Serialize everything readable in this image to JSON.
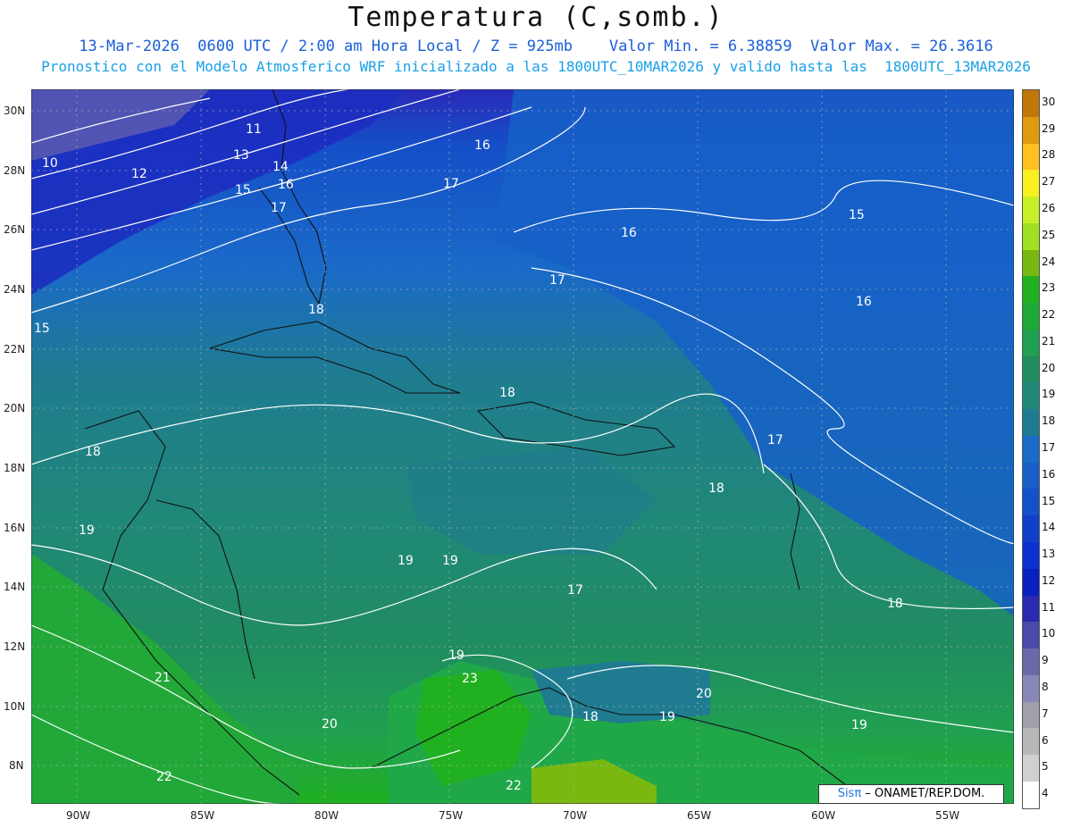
{
  "header": {
    "title": "Temperatura (C,somb.)",
    "line1": "13-Mar-2026  0600 UTC / 2:00 am Hora Local / Z = 925mb    Valor Min. = 6.38859  Valor Max. = 26.3616",
    "line2": "Pronostico con el Modelo Atmosferico WRF inicializado a las 1800UTC_10MAR2026 y valido hasta las  1800UTC_13MAR2026",
    "title_color": "#111111",
    "subtitle_color": "#1a5fd8",
    "line2_color": "#1aa0e8"
  },
  "map": {
    "lon_labels": [
      "90W",
      "85W",
      "80W",
      "75W",
      "70W",
      "65W",
      "60W",
      "55W"
    ],
    "lat_labels": [
      "30N",
      "28N",
      "26N",
      "24N",
      "22N",
      "20N",
      "18N",
      "16N",
      "14N",
      "12N",
      "10N",
      "8N"
    ],
    "contour_labels": [
      "10",
      "11",
      "12",
      "13",
      "14",
      "15",
      "16",
      "17",
      "15",
      "16",
      "17",
      "16",
      "15",
      "16",
      "18",
      "18",
      "17",
      "18",
      "17",
      "18",
      "19",
      "19",
      "19",
      "21",
      "20",
      "19",
      "23",
      "18",
      "19",
      "20",
      "19",
      "22",
      "22"
    ]
  },
  "colorbar": {
    "levels": [
      "30",
      "29",
      "28",
      "27",
      "26",
      "25",
      "24",
      "23",
      "22",
      "21",
      "20",
      "19",
      "18",
      "17",
      "16",
      "15",
      "14",
      "13",
      "12",
      "11",
      "10",
      "9",
      "8",
      "7",
      "6",
      "5",
      "4"
    ],
    "colors": [
      "#c07808",
      "#e09a10",
      "#ffc020",
      "#f8f020",
      "#c8f028",
      "#a0e020",
      "#78b810",
      "#20b020",
      "#20a838",
      "#20a050",
      "#208c60",
      "#208878",
      "#1f7c90",
      "#1a6ac8",
      "#1860c8",
      "#1450c8",
      "#1040c8",
      "#0c30d0",
      "#0820c0",
      "#2a2ab0",
      "#4a4aa8",
      "#6a6aaa",
      "#8888b8",
      "#a0a0a8",
      "#b8b8b8",
      "#d0d0d0",
      "#ffffff"
    ]
  },
  "credit": {
    "sis": "Sisπ",
    "rest": " – ONAMET/REP.DOM."
  }
}
